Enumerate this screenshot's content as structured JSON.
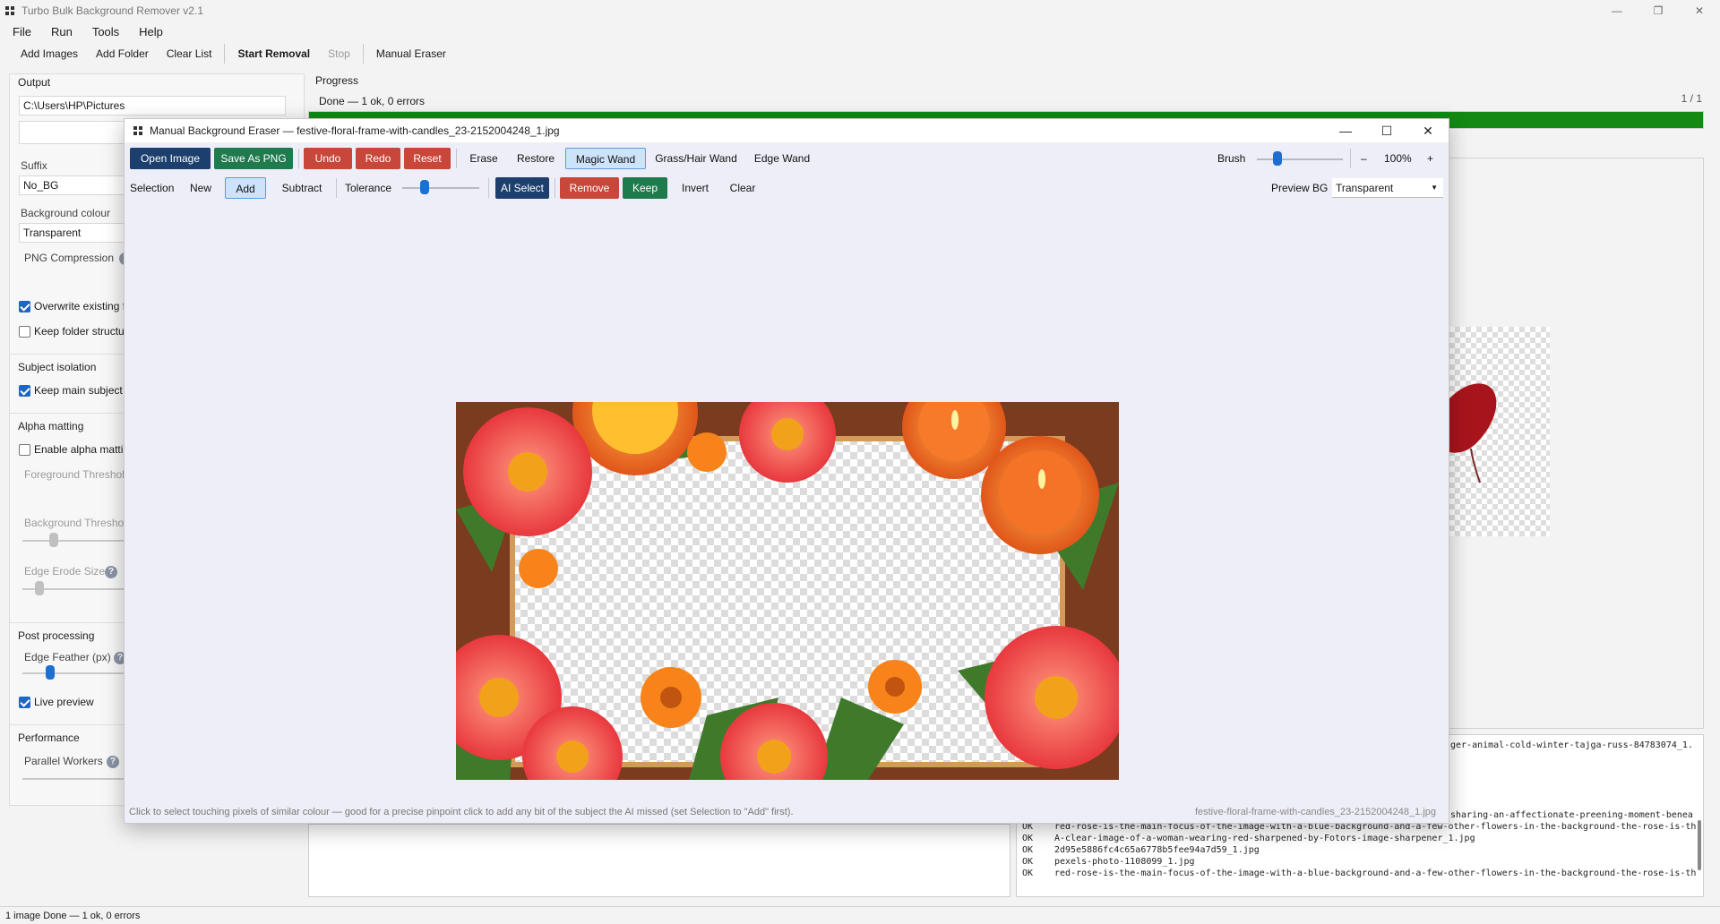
{
  "app": {
    "title": "Turbo Bulk Background Remover v2.1",
    "menu": [
      "File",
      "Run",
      "Tools",
      "Help"
    ],
    "toolbar": {
      "add_images": "Add Images",
      "add_folder": "Add Folder",
      "clear_list": "Clear List",
      "start_removal": "Start Removal",
      "stop": "Stop",
      "manual_eraser": "Manual Eraser"
    }
  },
  "settings": {
    "output_label": "Output",
    "output_path": "C:\\Users\\HP\\Pictures",
    "suffix_label": "Suffix",
    "suffix_value": "No_BG",
    "bg_colour_label": "Background colour",
    "bg_colour_value": "Transparent",
    "png_compression_label": "PNG Compression",
    "overwrite_label": "Overwrite existing f",
    "keep_folder_label": "Keep folder structu",
    "subject_isolation_label": "Subject isolation",
    "keep_main_subject_label": "Keep main subject",
    "alpha_matting_label": "Alpha matting",
    "enable_alpha_label": "Enable alpha mattin",
    "fg_threshold_label": "Foreground Threshol",
    "bg_threshold_label": "Background Threshol",
    "edge_erode_label": "Edge Erode Size",
    "post_processing_label": "Post processing",
    "edge_feather_label": "Edge Feather (px)",
    "live_preview_label": "Live preview",
    "performance_label": "Performance",
    "parallel_workers_label": "Parallel Workers",
    "help_glyph": "?",
    "overwrite_checked": true,
    "keep_folder_checked": false,
    "keep_main_subject_checked": true,
    "enable_alpha_checked": false,
    "live_preview_checked": true
  },
  "progress": {
    "label": "Progress",
    "status": "Done — 1 ok, 0 errors",
    "count": "1 / 1",
    "fraction": 1.0
  },
  "log": {
    "partial_top": "ger-animal-cold-winter-tajga-russ-84783074_1.",
    "partial_mid": "sharing-an-affectionate-preening-moment-benea",
    "entries": [
      {
        "status": "OK",
        "file": "red-rose-is-the-main-focus-of-the-image-with-a-blue-background-and-a-few-other-flowers-in-the-background-the-rose-is-th"
      },
      {
        "status": "OK",
        "file": "A-clear-image-of-a-woman-wearing-red-sharpened-by-Fotors-image-sharpener_1.jpg"
      },
      {
        "status": "OK",
        "file": "2d95e5886fc4c65a6778b5fee94a7d59_1.jpg"
      },
      {
        "status": "OK",
        "file": "pexels-photo-1108099_1.jpg"
      },
      {
        "status": "OK",
        "file": "red-rose-is-the-main-focus-of-the-image-with-a-blue-background-and-a-few-other-flowers-in-the-background-the-rose-is-th"
      }
    ]
  },
  "statusbar": {
    "text": "1 image  Done — 1 ok, 0 errors"
  },
  "dialog": {
    "title": "Manual Background Eraser — festive-floral-frame-with-candles_23-2152004248_1.jpg",
    "buttons": {
      "open_image": "Open Image",
      "save_png": "Save As PNG",
      "undo": "Undo",
      "redo": "Redo",
      "reset": "Reset",
      "erase": "Erase",
      "restore": "Restore",
      "magic_wand": "Magic Wand",
      "grass_hair_wand": "Grass/Hair Wand",
      "edge_wand": "Edge Wand",
      "ai_select": "AI Select",
      "remove": "Remove",
      "keep": "Keep",
      "invert": "Invert",
      "clear": "Clear"
    },
    "brush_label": "Brush",
    "zoom_minus": "–",
    "zoom_value": "100%",
    "zoom_plus": "+",
    "selection_label": "Selection",
    "selection_modes": [
      "New",
      "Add",
      "Subtract"
    ],
    "selected_mode": "Add",
    "tolerance_label": "Tolerance",
    "preview_bg_label": "Preview BG",
    "preview_bg_value": "Transparent",
    "hint": "Click to select touching pixels of similar colour — good for a precise pinpoint click to add any bit of the subject the AI missed (set Selection to \"Add\" first).",
    "footer_file": "festive-floral-frame-with-candles_23-2152004248_1.jpg"
  },
  "icons": {
    "app": "app-grid-icon",
    "minimize": "minimize-icon",
    "maximize": "maximize-icon",
    "close": "close-icon",
    "dropdown": "chevron-down-icon"
  },
  "colors": {
    "progress": "#138a13",
    "navy_button": "#1c3f6e",
    "green_button": "#1f7a4d",
    "red_button": "#c8463a",
    "selected_tool": "#cde3fa",
    "accent": "#1d6fd1"
  }
}
